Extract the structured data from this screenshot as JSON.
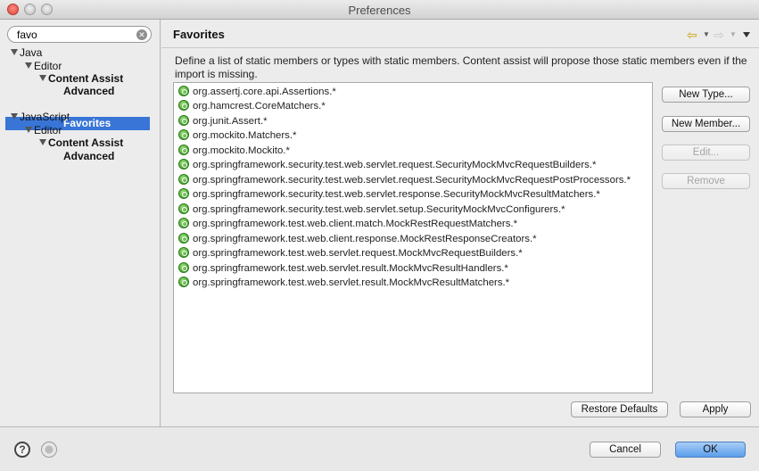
{
  "window": {
    "title": "Preferences"
  },
  "search": {
    "value": "favo"
  },
  "tree": [
    {
      "label": "Java"
    },
    {
      "label": "Editor"
    },
    {
      "label": "Content Assist"
    },
    {
      "label": "Advanced"
    },
    {
      "label": "Favorites",
      "selected": true
    },
    {
      "label": "JavaScript"
    },
    {
      "label": "Editor"
    },
    {
      "label": "Content Assist"
    },
    {
      "label": "Advanced"
    }
  ],
  "page": {
    "title": "Favorites",
    "description": "Define a list of static members or types with static members. Content assist will propose those static members even if the import is missing."
  },
  "favorites": [
    "org.assertj.core.api.Assertions.*",
    "org.hamcrest.CoreMatchers.*",
    "org.junit.Assert.*",
    "org.mockito.Matchers.*",
    "org.mockito.Mockito.*",
    "org.springframework.security.test.web.servlet.request.SecurityMockMvcRequestBuilders.*",
    "org.springframework.security.test.web.servlet.request.SecurityMockMvcRequestPostProcessors.*",
    "org.springframework.security.test.web.servlet.response.SecurityMockMvcResultMatchers.*",
    "org.springframework.security.test.web.servlet.setup.SecurityMockMvcConfigurers.*",
    "org.springframework.test.web.client.match.MockRestRequestMatchers.*",
    "org.springframework.test.web.client.response.MockRestResponseCreators.*",
    "org.springframework.test.web.servlet.request.MockMvcRequestBuilders.*",
    "org.springframework.test.web.servlet.result.MockMvcResultHandlers.*",
    "org.springframework.test.web.servlet.result.MockMvcResultMatchers.*"
  ],
  "buttons": {
    "new_type": "New Type...",
    "new_member": "New Member...",
    "edit": "Edit...",
    "remove": "Remove",
    "restore_defaults": "Restore Defaults",
    "apply": "Apply",
    "cancel": "Cancel",
    "ok": "OK"
  },
  "icons": {
    "clear": "clear-search-icon",
    "back": "back-arrow-icon",
    "forward": "forward-arrow-icon",
    "view_menu": "view-menu-icon",
    "help": "help-icon",
    "import": "import-export-icon",
    "favorite": "static-member-icon"
  },
  "colors": {
    "selection": "#3875d7",
    "default_button": "#5a9eea"
  }
}
